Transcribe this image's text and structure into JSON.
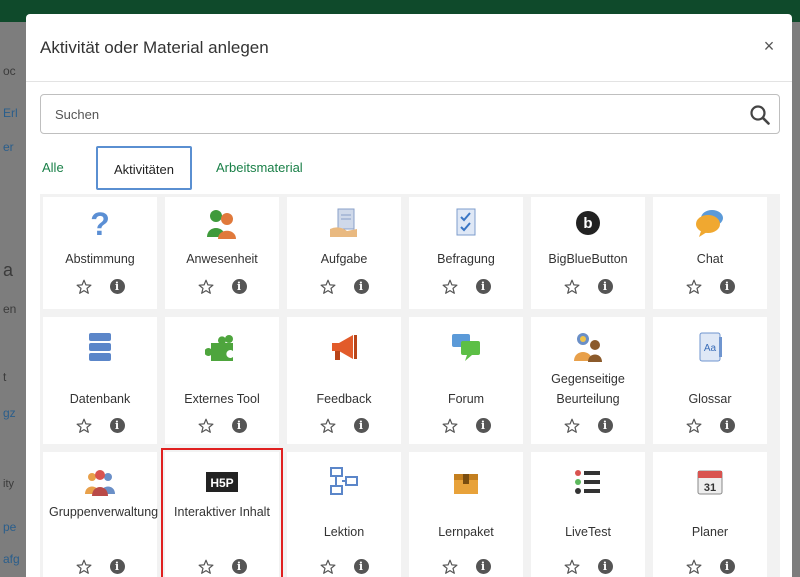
{
  "dialog": {
    "title": "Aktivität oder Material anlegen",
    "close_symbol": "×"
  },
  "search": {
    "placeholder": "Suchen"
  },
  "tabs": [
    {
      "label": "Alle",
      "active": false
    },
    {
      "label": "Aktivitäten",
      "active": true
    },
    {
      "label": "Arbeitsmaterial",
      "active": false
    }
  ],
  "background_fragments": [
    "oc",
    "Erl",
    "er",
    "a",
    "en",
    "t",
    "gz",
    "ity",
    "pe",
    "afg"
  ],
  "modules": [
    {
      "label": "Abstimmung",
      "icon": "question-icon"
    },
    {
      "label": "Anwesenheit",
      "icon": "attendance-icon"
    },
    {
      "label": "Aufgabe",
      "icon": "assignment-icon"
    },
    {
      "label": "Befragung",
      "icon": "survey-icon"
    },
    {
      "label": "BigBlueButton",
      "icon": "bigbluebutton-icon"
    },
    {
      "label": "Chat",
      "icon": "chat-icon"
    },
    {
      "label": "Datenbank",
      "icon": "database-icon"
    },
    {
      "label": "Externes Tool",
      "icon": "puzzle-icon"
    },
    {
      "label": "Feedback",
      "icon": "megaphone-icon"
    },
    {
      "label": "Forum",
      "icon": "forum-icon"
    },
    {
      "label": "Gegenseitige Beurteilung",
      "icon": "workshop-icon"
    },
    {
      "label": "Glossar",
      "icon": "glossary-icon"
    },
    {
      "label": "Gruppenverwaltung",
      "icon": "group-icon"
    },
    {
      "label": "Interaktiver Inhalt",
      "icon": "h5p-icon",
      "highlighted": true
    },
    {
      "label": "Lektion",
      "icon": "lesson-icon"
    },
    {
      "label": "Lernpaket",
      "icon": "package-icon"
    },
    {
      "label": "LiveTest",
      "icon": "list-icon"
    },
    {
      "label": "Planer",
      "icon": "calendar-icon"
    }
  ],
  "icon_badge": {
    "h5p_text": "H5P",
    "calendar_day": "31",
    "glossary_text": "Aa",
    "info_glyph": "i"
  },
  "colors": {
    "accent": "#1a8048",
    "tab_border": "#5a8fd1",
    "highlight": "#e02020",
    "topbar": "#0f4a2b"
  }
}
